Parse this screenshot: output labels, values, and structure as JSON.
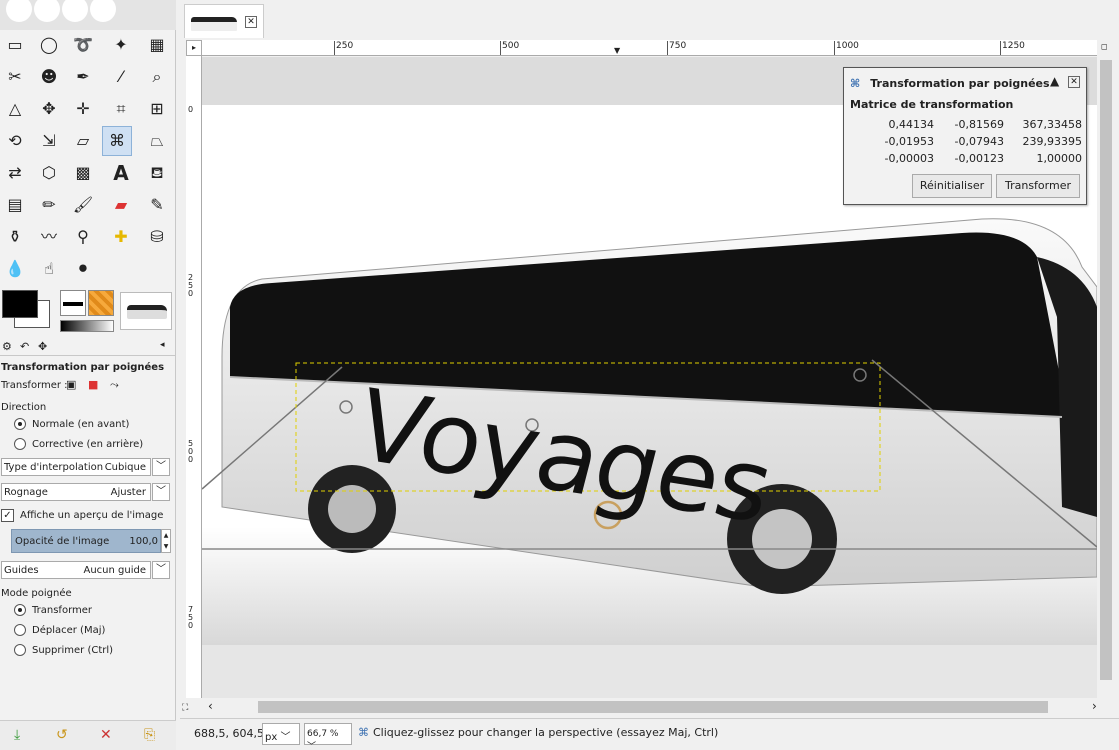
{
  "toolbox": {
    "tool_options_title": "Transformation par poignées",
    "transform_label": "Transformer :",
    "direction_label": "Direction",
    "direction_options": [
      "Normale (en avant)",
      "Corrective (en arrière)"
    ],
    "interpolation_label": "Type d'interpolation",
    "interpolation_value": "Cubique",
    "clipping_label": "Rognage",
    "clipping_value": "Ajuster",
    "preview_label": "Affiche un aperçu de l'image",
    "opacity_label": "Opacité de l'image",
    "opacity_value": "100,0",
    "guides_label": "Guides",
    "guides_value": "Aucun guide",
    "handle_mode_label": "Mode poignée",
    "handle_modes": [
      "Transformer",
      "Déplacer (Maj)",
      "Supprimer (Ctrl)"
    ]
  },
  "rulers": {
    "top_labels": [
      "250",
      "500",
      "750",
      "1000",
      "1250"
    ],
    "left_labels": [
      "0",
      "250",
      "500",
      "750"
    ]
  },
  "canvas": {
    "text_on_bus": "Voyages"
  },
  "dialog": {
    "title": "Transformation par poignées",
    "subtitle": "Matrice de transformation",
    "matrix": [
      [
        "0,44134",
        "-0,81569",
        "367,33458"
      ],
      [
        "-0,01953",
        "-0,07943",
        "239,93395"
      ],
      [
        "-0,00003",
        "-0,00123",
        "1,00000"
      ]
    ],
    "reset_label": "Réinitialiser",
    "transform_label": "Transformer"
  },
  "status": {
    "coords": "688,5, 604,5",
    "unit": "px",
    "zoom": "66,7 %",
    "message": "Cliquez-glissez pour changer la perspective (essayez Maj, Ctrl)"
  },
  "colors": {
    "accent": "#3a6fb0",
    "selection": "#f5e500",
    "opacity_bar": "#9fb6cd"
  }
}
